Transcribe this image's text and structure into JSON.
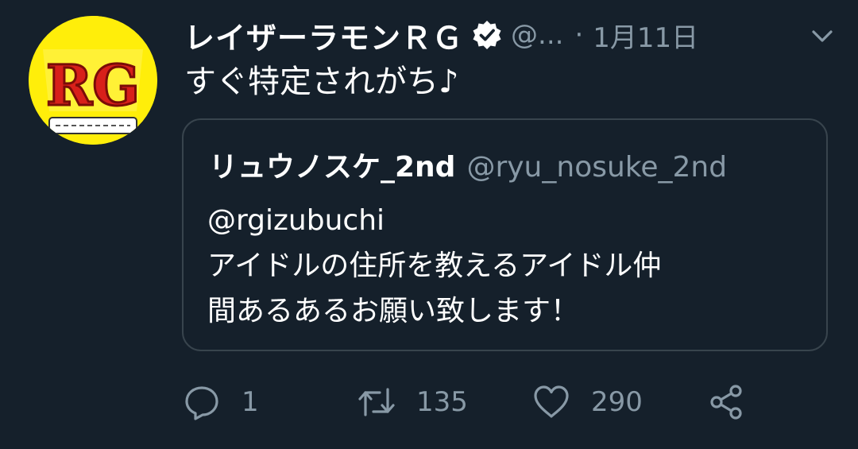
{
  "author": {
    "display_name": "レイザーラモンＲＧ",
    "handle": "@...",
    "separator": "·",
    "date": "1月11日",
    "avatar_logo_text": "RG",
    "verified_icon": "verified-badge-icon",
    "menu_icon": "chevron-down-icon"
  },
  "tweet": {
    "text": "すぐ特定されがち♪"
  },
  "quoted_tweet": {
    "display_name": "リュウノスケ_2nd",
    "handle": "@ryu_nosuke_2nd",
    "text": "@rgizubuchi\nアイドルの住所を教えるアイドル仲\n間あるあるお願い致します！"
  },
  "actions": {
    "reply": {
      "icon": "reply-icon",
      "count": "1"
    },
    "retweet": {
      "icon": "retweet-icon",
      "count": "135"
    },
    "like": {
      "icon": "heart-icon",
      "count": "290"
    },
    "share": {
      "icon": "share-icon"
    }
  },
  "colors": {
    "background": "#15202b",
    "text_primary": "#ffffff",
    "text_secondary": "#8899a6",
    "border": "#38444d",
    "avatar_bg": "#ffee0a",
    "avatar_logo": "#d8201a"
  }
}
